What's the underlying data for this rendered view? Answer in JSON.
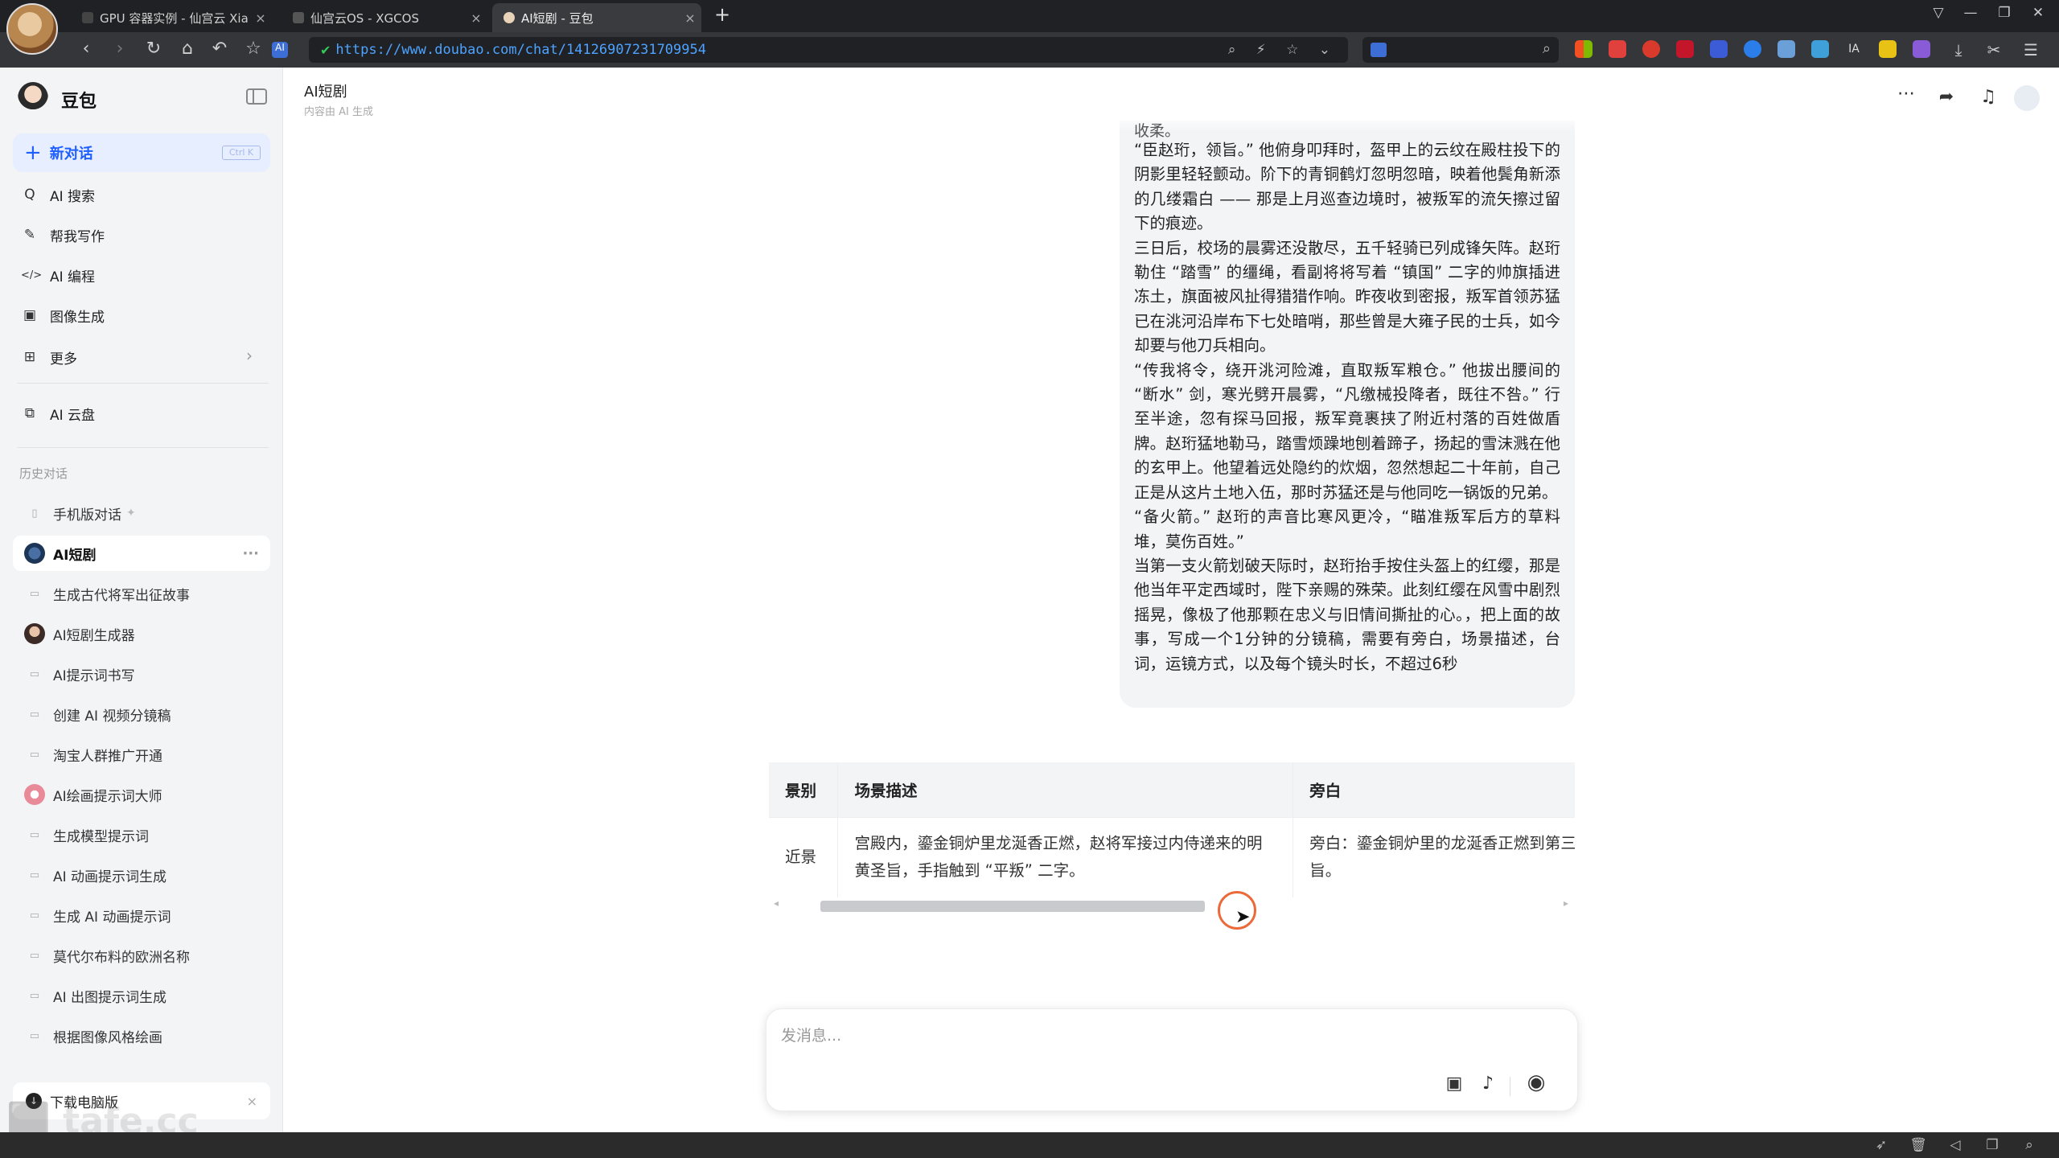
{
  "browser": {
    "tabs": [
      {
        "title": "GPU 容器实例 - 仙宫云 Xian",
        "favicon": "gpu-cloud-favicon"
      },
      {
        "title": "仙宫云OS - XGCOS",
        "favicon": "xgcos-favicon"
      },
      {
        "title": "AI短剧 - 豆包",
        "favicon": "doubao-favicon"
      }
    ],
    "new_tab": "+",
    "url": "https://www.doubao.com/chat/14126907231709954"
  },
  "sidebar": {
    "brand": "豆包",
    "new_chat": "新对话",
    "new_chat_shortcut": "Ctrl K",
    "menu": [
      {
        "label": "AI 搜索",
        "icon": "search-icon",
        "glyph": "Q"
      },
      {
        "label": "帮我写作",
        "icon": "pen-icon",
        "glyph": "✎"
      },
      {
        "label": "AI 编程",
        "icon": "code-icon",
        "glyph": "</>"
      },
      {
        "label": "图像生成",
        "icon": "image-icon",
        "glyph": "▣"
      },
      {
        "label": "更多",
        "icon": "grid-icon",
        "glyph": "⊞"
      }
    ],
    "cloud": "AI 云盘",
    "history_label": "历史对话",
    "history": [
      {
        "label": "手机版对话",
        "icon": "phone-icon"
      },
      {
        "label": "AI短剧",
        "icon": "avatar-icon"
      },
      {
        "label": "生成古代将军出征故事",
        "icon": "chat-icon"
      },
      {
        "label": "AI短剧生成器",
        "icon": "avatar-icon"
      },
      {
        "label": "AI提示词书写",
        "icon": "chat-icon"
      },
      {
        "label": "创建 AI 视频分镜稿",
        "icon": "chat-icon"
      },
      {
        "label": "淘宝人群推广开通",
        "icon": "chat-icon"
      },
      {
        "label": "AI绘画提示词大师",
        "icon": "avatar-icon"
      },
      {
        "label": "生成模型提示词",
        "icon": "chat-icon"
      },
      {
        "label": "AI 动画提示词生成",
        "icon": "chat-icon"
      },
      {
        "label": "生成 AI 动画提示词",
        "icon": "chat-icon"
      },
      {
        "label": "莫代尔布料的欧洲名称",
        "icon": "chat-icon"
      },
      {
        "label": "AI 出图提示词生成",
        "icon": "chat-icon"
      },
      {
        "label": "根据图像风格绘画",
        "icon": "chat-icon"
      }
    ],
    "download": "下载电脑版"
  },
  "chat": {
    "title": "AI短剧",
    "subtitle": "内容由 AI 生成",
    "message_cut_top": "收柔。",
    "message_paragraphs": [
      "“臣赵珩，领旨。” 他俯身叩拜时，盔甲上的云纹在殿柱投下的阴影里轻轻颤动。阶下的青铜鹤灯忽明忽暗，映着他鬓角新添的几缕霜白 —— 那是上月巡查边境时，被叛军的流矢擦过留下的痕迹。",
      "三日后，校场的晨雾还没散尽，五千轻骑已列成锋矢阵。赵珩勒住 “踏雪” 的缰绳，看副将将写着 “镇国” 二字的帅旗插进冻土，旗面被风扯得猎猎作响。昨夜收到密报，叛军首领苏猛已在洮河沿岸布下七处暗哨，那些曾是大雍子民的士兵，如今却要与他刀兵相向。",
      "“传我将令，绕开洮河险滩，直取叛军粮仓。” 他拔出腰间的 “断水” 剑，寒光劈开晨雾，“凡缴械投降者，既往不咎。” 行至半途，忽有探马回报，叛军竟裹挟了附近村落的百姓做盾牌。赵珩猛地勒马，踏雪烦躁地刨着蹄子，扬起的雪沫溅在他的玄甲上。他望着远处隐约的炊烟，忽然想起二十年前，自己正是从这片土地入伍，那时苏猛还是与他同吃一锅饭的兄弟。",
      "“备火箭。” 赵珩的声音比寒风更冷，“瞄准叛军后方的草料堆，莫伤百姓。”",
      "当第一支火箭划破天际时，赵珩抬手按住头盔上的红缨，那是他当年平定西域时，陛下亲赐的殊荣。此刻红缨在风雪中剧烈摇晃，像极了他那颗在忠义与旧情间撕扯的心。，把上面的故事，写成一个1分钟的分镜稿，需要有旁白，场景描述，台词，运镜方式，以及每个镜头时长，不超过6秒"
    ],
    "table": {
      "headers": [
        "景别",
        "场景描述",
        "旁白"
      ],
      "rows": [
        [
          "近景",
          "宫殿内，鎏金铜炉里龙涎香正燃，赵将军接过内侍递来的明黄圣旨，手指触到 “平叛” 二字。",
          "旁白：鎏金铜炉里的龙涎香正燃到第三炷香时，赵将军接过了这道平叛圣旨。"
        ]
      ]
    },
    "composer_placeholder": "发消息..."
  },
  "colors": {
    "accent": "#1f5fff",
    "sidebar_bg": "#f3f4f6",
    "bubble_bg": "#f3f4f6",
    "cursor_ring": "#ea6a3a"
  }
}
